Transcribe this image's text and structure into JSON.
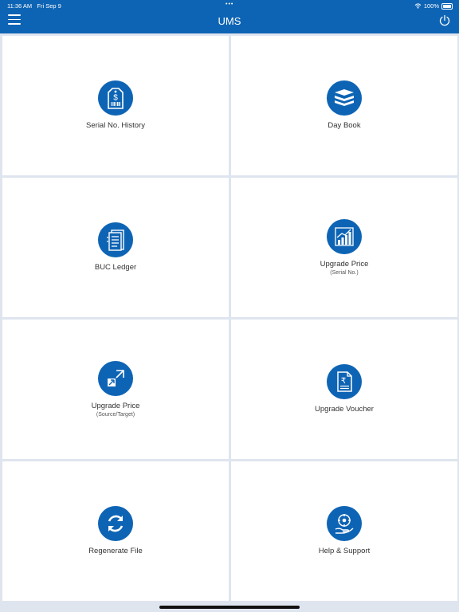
{
  "status": {
    "time": "11:36 AM",
    "date": "Fri Sep 9",
    "battery": "100%"
  },
  "header": {
    "title": "UMS"
  },
  "tiles": [
    {
      "label": "Serial No. History",
      "sub": "",
      "icon": "price-tag-icon"
    },
    {
      "label": "Day Book",
      "sub": "",
      "icon": "book-stack-icon"
    },
    {
      "label": "BUC Ledger",
      "sub": "",
      "icon": "ledger-icon"
    },
    {
      "label": "Upgrade Price",
      "sub": "(Serial No.)",
      "icon": "growth-chart-icon"
    },
    {
      "label": "Upgrade Price",
      "sub": "(Source/Target)",
      "icon": "upgrade-arrow-icon"
    },
    {
      "label": "Upgrade Voucher",
      "sub": "",
      "icon": "rupee-voucher-icon"
    },
    {
      "label": "Regenerate File",
      "sub": "",
      "icon": "refresh-icon"
    },
    {
      "label": "Help & Support",
      "sub": "",
      "icon": "support-icon"
    }
  ],
  "colors": {
    "primary": "#0e64b4",
    "background": "#dfe5ef"
  }
}
